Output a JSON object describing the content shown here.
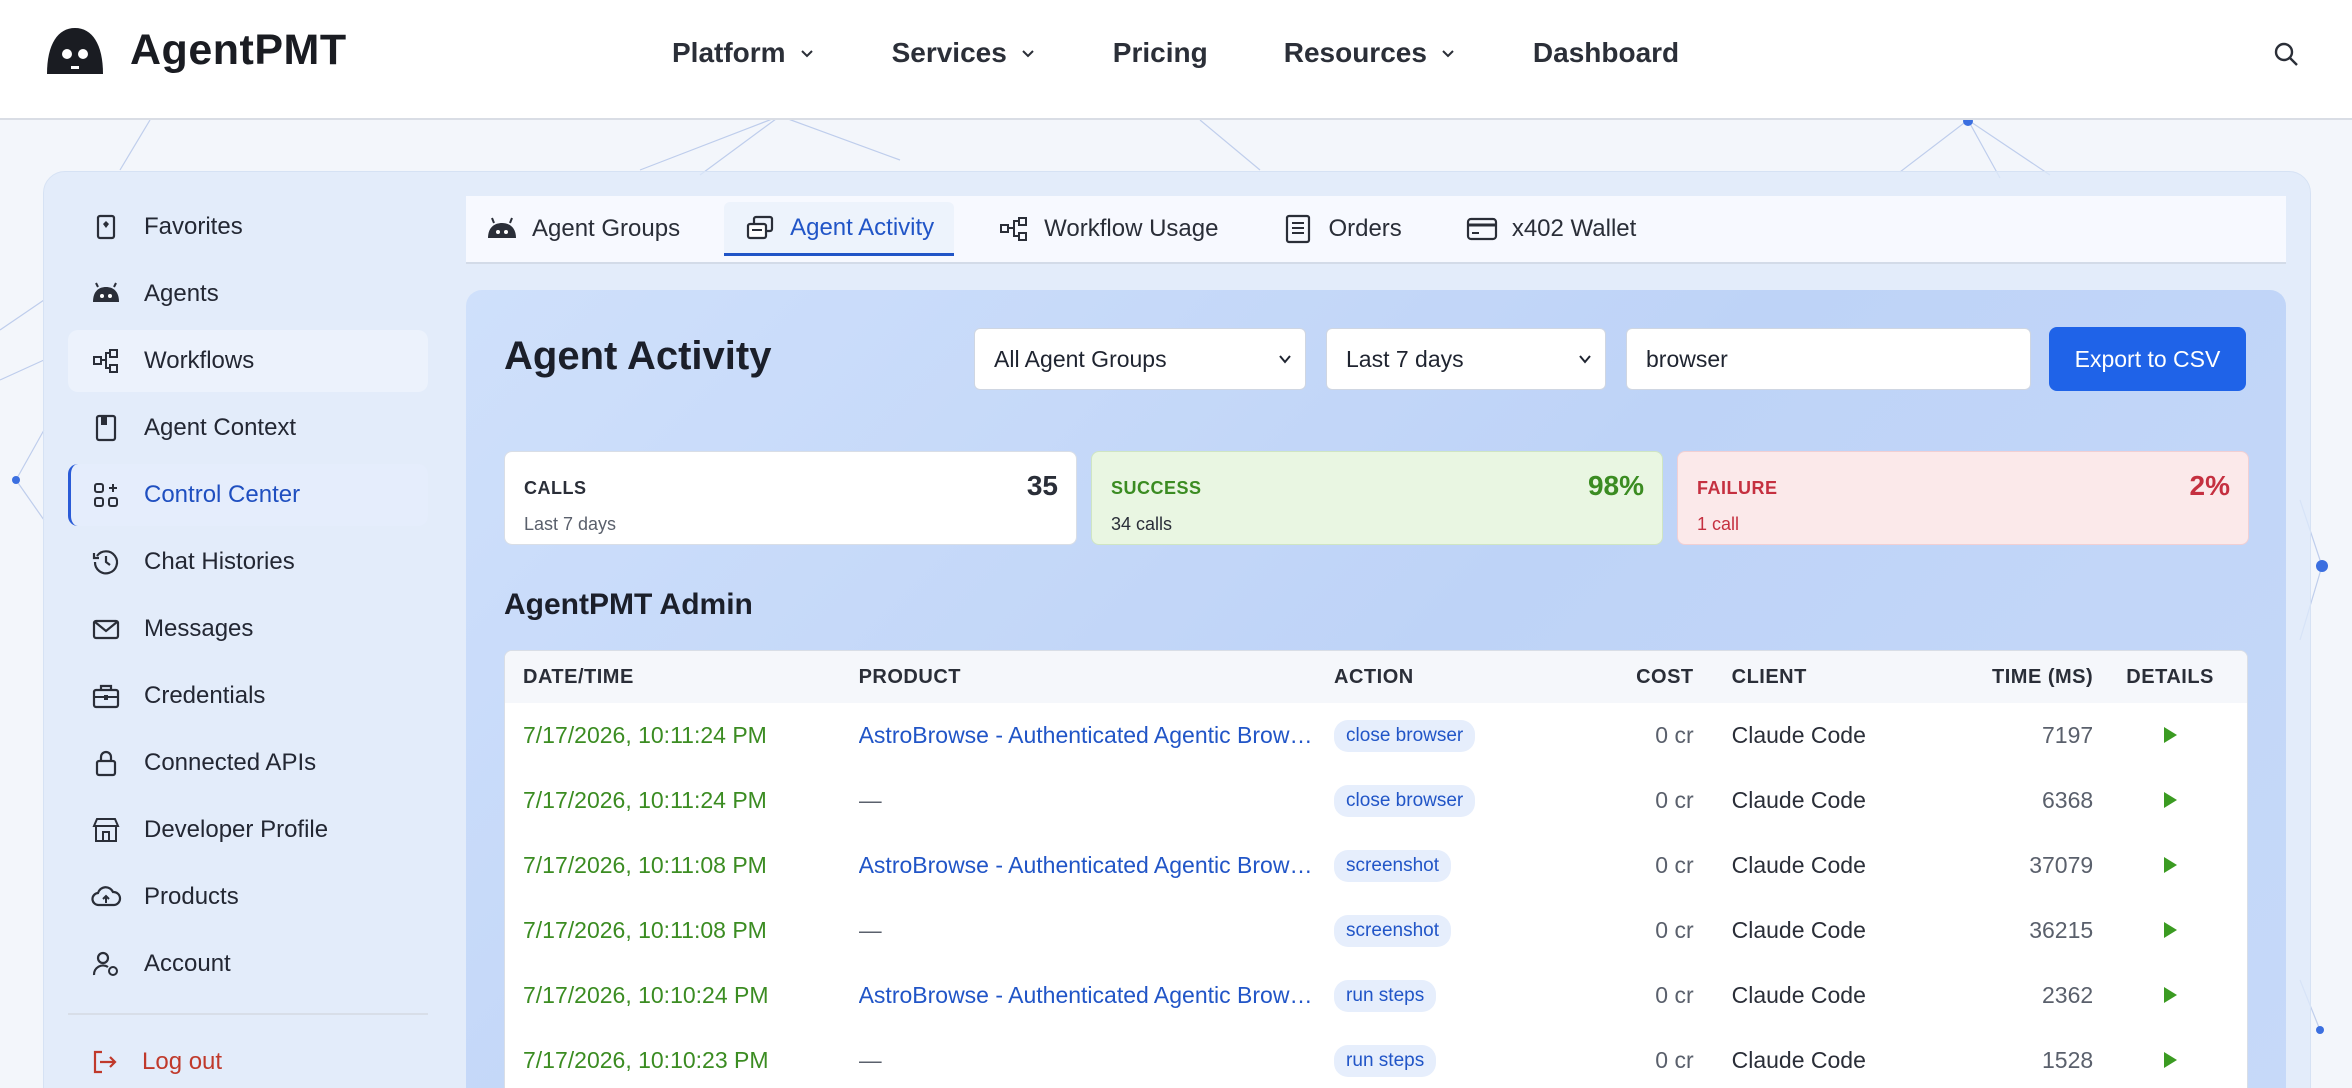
{
  "brand": {
    "name": "AgentPMT"
  },
  "nav": [
    {
      "label": "Platform",
      "dropdown": true
    },
    {
      "label": "Services",
      "dropdown": true
    },
    {
      "label": "Pricing",
      "dropdown": false
    },
    {
      "label": "Resources",
      "dropdown": true
    },
    {
      "label": "Dashboard",
      "dropdown": false
    }
  ],
  "sidebar": {
    "items": [
      {
        "label": "Favorites",
        "icon": "bookmark-icon"
      },
      {
        "label": "Agents",
        "icon": "robot-icon"
      },
      {
        "label": "Workflows",
        "icon": "workflow-icon"
      },
      {
        "label": "Agent Context",
        "icon": "book-icon"
      },
      {
        "label": "Control Center",
        "icon": "grid-icon",
        "active": true
      },
      {
        "label": "Chat Histories",
        "icon": "history-icon"
      },
      {
        "label": "Messages",
        "icon": "mail-icon"
      },
      {
        "label": "Credentials",
        "icon": "briefcase-icon"
      },
      {
        "label": "Connected APIs",
        "icon": "lock-icon"
      },
      {
        "label": "Developer Profile",
        "icon": "store-icon"
      },
      {
        "label": "Products",
        "icon": "cloud-upload-icon"
      },
      {
        "label": "Account",
        "icon": "user-gear-icon"
      }
    ],
    "logout_label": "Log out"
  },
  "tabs": [
    {
      "label": "Agent Groups",
      "icon": "robot-icon"
    },
    {
      "label": "Agent Activity",
      "icon": "activity-icon",
      "active": true
    },
    {
      "label": "Workflow Usage",
      "icon": "workflow-icon"
    },
    {
      "label": "Orders",
      "icon": "receipt-icon"
    },
    {
      "label": "x402 Wallet",
      "icon": "card-icon"
    }
  ],
  "panel": {
    "title": "Agent Activity",
    "group_select": "All Agent Groups",
    "range_select": "Last 7 days",
    "search_value": "browser",
    "export_label": "Export to CSV"
  },
  "stats": {
    "calls": {
      "label": "CALLS",
      "sub": "Last 7 days",
      "value": "35"
    },
    "success": {
      "label": "SUCCESS",
      "sub": "34 calls",
      "value": "98%"
    },
    "failure": {
      "label": "FAILURE",
      "sub": "1 call",
      "value": "2%"
    }
  },
  "section_title": "AgentPMT Admin",
  "table": {
    "headers": {
      "date": "DATE/TIME",
      "product": "PRODUCT",
      "action": "ACTION",
      "cost": "COST",
      "client": "CLIENT",
      "time": "TIME (MS)",
      "details": "DETAILS"
    },
    "rows": [
      {
        "date": "7/17/2026, 10:11:24 PM",
        "product": "AstroBrowse - Authenticated Agentic Browser",
        "action": "close browser",
        "cost": "0 cr",
        "client": "Claude Code",
        "time": "7197"
      },
      {
        "date": "7/17/2026, 10:11:24 PM",
        "product": "—",
        "action": "close browser",
        "cost": "0 cr",
        "client": "Claude Code",
        "time": "6368"
      },
      {
        "date": "7/17/2026, 10:11:08 PM",
        "product": "AstroBrowse - Authenticated Agentic Browser",
        "action": "screenshot",
        "cost": "0 cr",
        "client": "Claude Code",
        "time": "37079"
      },
      {
        "date": "7/17/2026, 10:11:08 PM",
        "product": "—",
        "action": "screenshot",
        "cost": "0 cr",
        "client": "Claude Code",
        "time": "36215"
      },
      {
        "date": "7/17/2026, 10:10:24 PM",
        "product": "AstroBrowse - Authenticated Agentic Browser",
        "action": "run steps",
        "cost": "0 cr",
        "client": "Claude Code",
        "time": "2362"
      },
      {
        "date": "7/17/2026, 10:10:23 PM",
        "product": "—",
        "action": "run steps",
        "cost": "0 cr",
        "client": "Claude Code",
        "time": "1528"
      }
    ]
  },
  "colors": {
    "accent": "#1f63e8",
    "success": "#3b8c22",
    "failure": "#c53040",
    "link": "#2155c7"
  }
}
